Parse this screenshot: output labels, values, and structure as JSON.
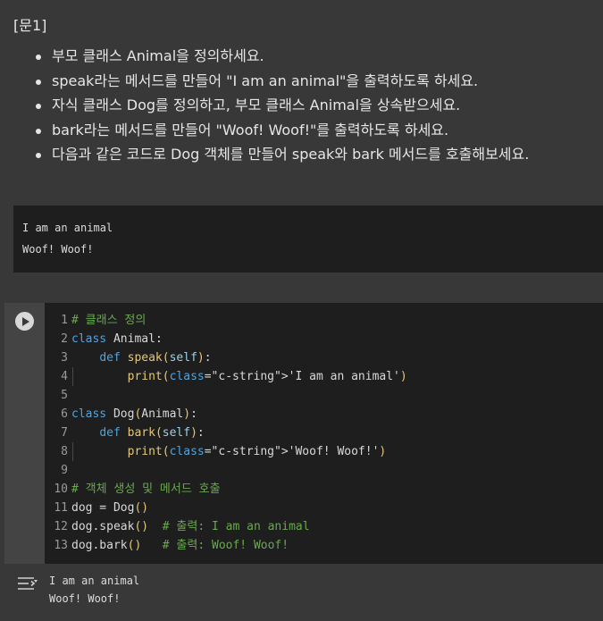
{
  "markdown": {
    "title": "[문1]",
    "items": [
      "부모 클래스 Animal을 정의하세요.",
      "speak라는 메서드를 만들어 \"I am an animal\"을 출력하도록 하세요.",
      "자식 클래스 Dog를 정의하고, 부모 클래스 Animal을 상속받으세요.",
      "bark라는 메서드를 만들어 \"Woof! Woof!\"를 출력하도록 하세요.",
      "다음과 같은 코드로 Dog 객체를 만들어 speak와 bark 메서드를 호출해보세요."
    ]
  },
  "first_output": {
    "lines": [
      "I am an animal",
      "Woof! Woof!"
    ]
  },
  "code_cell": {
    "run_button_icon": "play-icon",
    "line_numbers": [
      "1",
      "2",
      "3",
      "4",
      "5",
      "6",
      "7",
      "8",
      "9",
      "10",
      "11",
      "12",
      "13"
    ],
    "lines": [
      "# 클래스 정의",
      "class Animal:",
      "    def speak(self):",
      "        print('I am an animal')",
      "",
      "class Dog(Animal):",
      "    def bark(self):",
      "        print('Woof! Woof!')",
      "",
      "# 객체 생성 및 메서드 호출",
      "dog = Dog()",
      "dog.speak()  # 출력: I am an animal",
      "dog.bark()   # 출력: Woof! Woof!"
    ]
  },
  "cell_output": {
    "icon": "output-options-icon",
    "lines": [
      "I am an animal",
      "Woof! Woof!"
    ]
  },
  "colors": {
    "background": "#383838",
    "editor_background": "#1e1e1e",
    "comment": "#6aa84f",
    "keyword": "#4fa4e0",
    "string": "#e69a6d",
    "function": "#e3c77a"
  }
}
